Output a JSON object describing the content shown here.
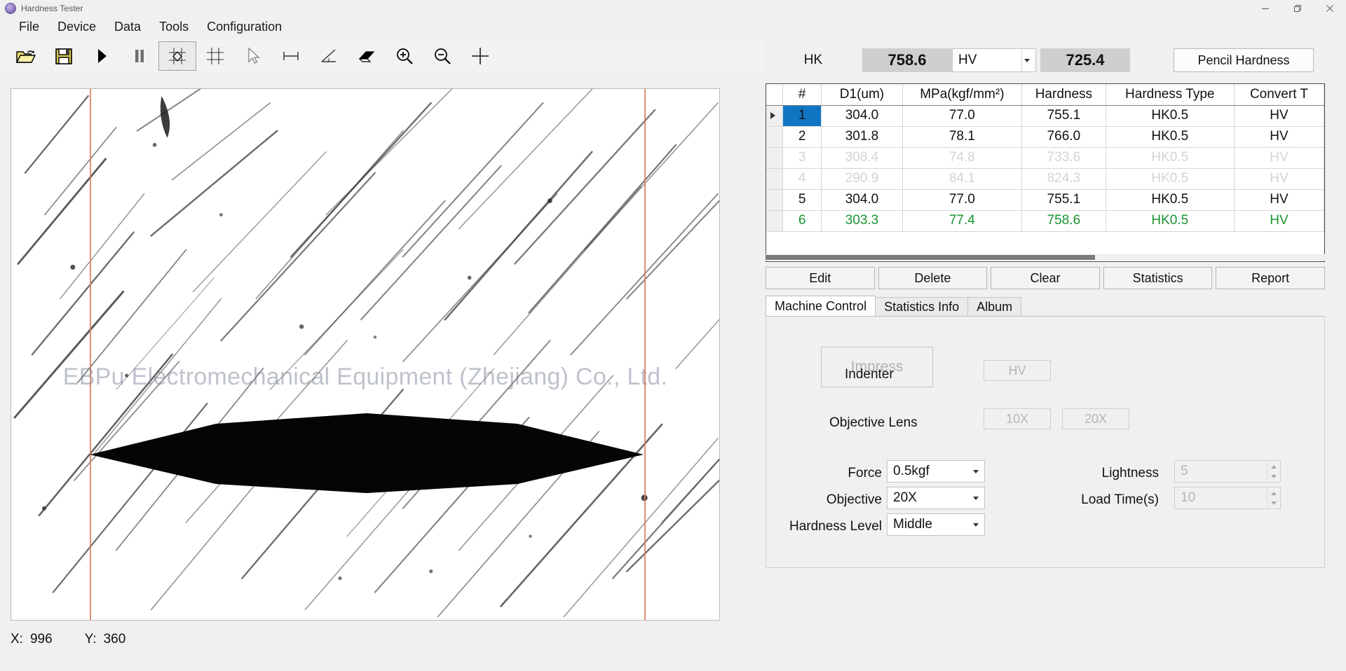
{
  "window": {
    "title": "Hardness Tester",
    "icon": "app-icon",
    "controls": {
      "minimize": "minimize-icon",
      "maximize": "maximize-icon",
      "close": "close-icon"
    }
  },
  "menubar": {
    "items": [
      {
        "label": "File"
      },
      {
        "label": "Device"
      },
      {
        "label": "Data"
      },
      {
        "label": "Tools"
      },
      {
        "label": "Configuration"
      }
    ]
  },
  "toolbar": {
    "items": [
      {
        "name": "open-folder-icon",
        "title": "Open"
      },
      {
        "name": "save-icon",
        "title": "Save"
      },
      {
        "name": "play-icon",
        "title": "Start"
      },
      {
        "name": "pause-icon",
        "title": "Pause"
      },
      {
        "name": "measure-diamond-icon",
        "title": "Measure Indent",
        "active": true
      },
      {
        "name": "grid-icon",
        "title": "Grid"
      },
      {
        "name": "cursor-arrow-icon",
        "title": "Select"
      },
      {
        "name": "length-measure-icon",
        "title": "Length"
      },
      {
        "name": "angle-measure-icon",
        "title": "Angle"
      },
      {
        "name": "eraser-icon",
        "title": "Erase"
      },
      {
        "name": "zoom-in-icon",
        "title": "Zoom In"
      },
      {
        "name": "zoom-out-icon",
        "title": "Zoom Out"
      },
      {
        "name": "crosshair-icon",
        "title": "Crosshair"
      }
    ]
  },
  "viewport": {
    "watermark": "EBPu Electromechanical Equipment (Zhejiang) Co., Ltd."
  },
  "statusbar": {
    "x_label": "X:",
    "x_value": "996",
    "y_label": "Y:",
    "y_value": "360"
  },
  "header": {
    "scale_label": "HK",
    "primary_value": "758.6",
    "convert_scale": "HV",
    "converted_value": "725.4",
    "pencil_hardness_button": "Pencil Hardness"
  },
  "table": {
    "columns": [
      "#",
      "D1(um)",
      "MPa(kgf/mm²)",
      "Hardness",
      "Hardness Type",
      "Convert T"
    ],
    "rows": [
      {
        "num": "1",
        "d1": "304.0",
        "mpa": "77.0",
        "hardness": "755.1",
        "type": "HK0.5",
        "convert": "HV",
        "state": "selected"
      },
      {
        "num": "2",
        "d1": "301.8",
        "mpa": "78.1",
        "hardness": "766.0",
        "type": "HK0.5",
        "convert": "HV",
        "state": "normal"
      },
      {
        "num": "3",
        "d1": "308.4",
        "mpa": "74.8",
        "hardness": "733.6",
        "type": "HK0.5",
        "convert": "HV",
        "state": "dim"
      },
      {
        "num": "4",
        "d1": "290.9",
        "mpa": "84.1",
        "hardness": "824.3",
        "type": "HK0.5",
        "convert": "HV",
        "state": "dim"
      },
      {
        "num": "5",
        "d1": "304.0",
        "mpa": "77.0",
        "hardness": "755.1",
        "type": "HK0.5",
        "convert": "HV",
        "state": "normal"
      },
      {
        "num": "6",
        "d1": "303.3",
        "mpa": "77.4",
        "hardness": "758.6",
        "type": "HK0.5",
        "convert": "HV",
        "state": "green"
      }
    ]
  },
  "actions": {
    "buttons": [
      "Edit",
      "Delete",
      "Clear",
      "Statistics",
      "Report"
    ]
  },
  "tabs": {
    "items": [
      {
        "label": "Machine Control",
        "active": true
      },
      {
        "label": "Statistics Info",
        "active": false
      },
      {
        "label": "Album",
        "active": false
      }
    ]
  },
  "machine_control": {
    "impress_button": "Impress",
    "indenter_label": "Indenter",
    "indenter_value": "HV",
    "objective_lens_label": "Objective Lens",
    "lens_10x": "10X",
    "lens_20x": "20X",
    "force_label": "Force",
    "force_value": "0.5kgf",
    "objective_label": "Objective",
    "objective_value": "20X",
    "hardness_level_label": "Hardness Level",
    "hardness_level_value": "Middle",
    "lightness_label": "Lightness",
    "lightness_value": "5",
    "load_time_label": "Load Time(s)",
    "load_time_value": "10"
  },
  "colors": {
    "accent_selection": "#1076c4",
    "green_row": "#1a9431",
    "guide_line": "#e07a5f",
    "readout_bg": "#cfcfcf"
  }
}
